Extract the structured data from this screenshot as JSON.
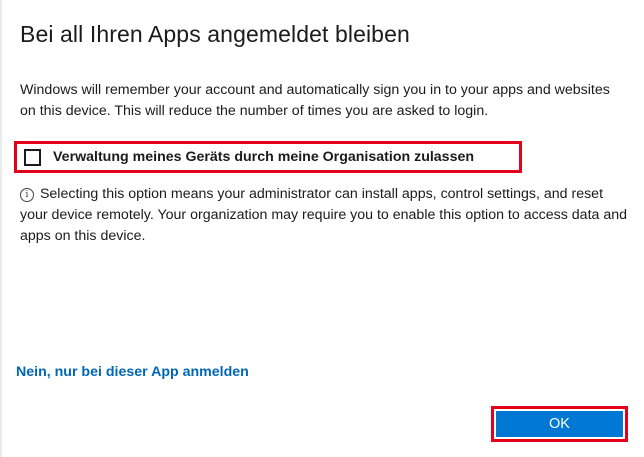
{
  "dialog": {
    "title": "Bei all Ihren Apps angemeldet bleiben",
    "description": "Windows will remember your account and automatically sign you in to your apps and websites on this device. This will reduce the number of times you are asked to login.",
    "checkbox": {
      "label": "Verwaltung meines Geräts durch meine Organisation zulassen",
      "checked": false
    },
    "info": {
      "icon_glyph": "i",
      "icon": "info-circle-icon",
      "text": "Selecting this option means your administrator can install apps, control settings, and reset your device remotely. Your organization may require you to enable this option to access data and apps on this device."
    },
    "alt_link": "Nein, nur bei dieser App anmelden",
    "ok_label": "OK"
  },
  "colors": {
    "accent": "#0078d4",
    "link": "#0067b8",
    "highlight": "#e2001a",
    "text": "#1b1b1b"
  }
}
